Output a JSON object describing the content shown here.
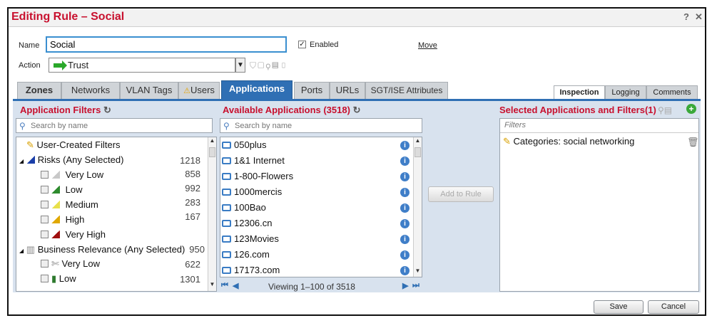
{
  "dialog": {
    "title": "Editing Rule – Social",
    "help": "?",
    "close": "✕"
  },
  "form": {
    "name_label": "Name",
    "name_value": "Social",
    "enabled_label": "Enabled",
    "enabled_checked": true,
    "move_label": "Move",
    "action_label": "Action",
    "action_value": "Trust"
  },
  "tabs": [
    {
      "label": "Zones"
    },
    {
      "label": "Networks"
    },
    {
      "label": "VLAN Tags"
    },
    {
      "label": "Users",
      "warning": true
    },
    {
      "label": "Applications",
      "active": true
    },
    {
      "label": "Ports"
    },
    {
      "label": "URLs"
    },
    {
      "label": "SGT/ISE Attributes"
    }
  ],
  "right_tabs": [
    {
      "label": "Inspection",
      "active": true
    },
    {
      "label": "Logging"
    },
    {
      "label": "Comments"
    }
  ],
  "filters_panel": {
    "title": "Application Filters",
    "search_placeholder": "Search by name",
    "items": [
      {
        "label": "User-Created Filters",
        "count": ""
      },
      {
        "label": "Risks (Any Selected)",
        "count": "1218"
      },
      {
        "label": "Very Low",
        "count": "858"
      },
      {
        "label": "Low",
        "count": "992"
      },
      {
        "label": "Medium",
        "count": "283"
      },
      {
        "label": "High",
        "count": "167"
      },
      {
        "label": "Very High",
        "count": ""
      },
      {
        "label": "Business Relevance (Any Selected)",
        "count": "950"
      },
      {
        "label": "Very Low",
        "count": "622"
      },
      {
        "label": "Low",
        "count": "1301"
      }
    ]
  },
  "available_panel": {
    "title": "Available Applications (3518)",
    "search_placeholder": "Search by name",
    "apps": [
      "050plus",
      "1&1 Internet",
      "1-800-Flowers",
      "1000mercis",
      "100Bao",
      "12306.cn",
      "123Movies",
      "126.com",
      "17173.com"
    ],
    "pager": "Viewing 1–100 of 3518"
  },
  "add_button": "Add to Rule",
  "selected_panel": {
    "title": "Selected Applications and Filters(1)",
    "filters_placeholder": "Filters",
    "items": [
      "Categories: social networking"
    ]
  },
  "footer": {
    "save": "Save",
    "cancel": "Cancel"
  },
  "colors": {
    "accent": "#c8102e",
    "tab_active": "#2f6fb4",
    "panel_bg": "#d8e2ee"
  }
}
